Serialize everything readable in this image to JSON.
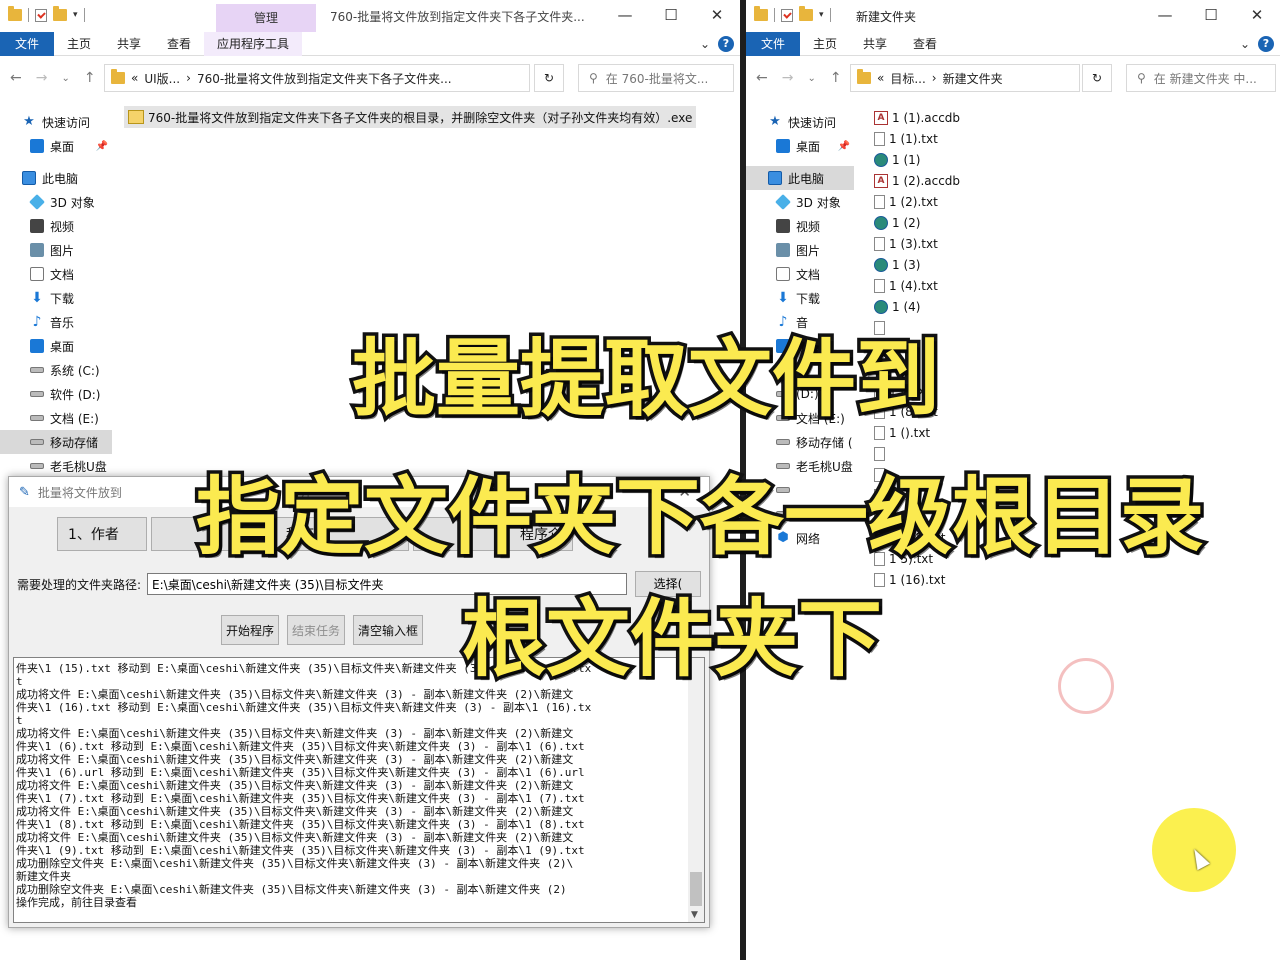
{
  "left": {
    "manage_tab": "管理",
    "title": "760-批量将文件放到指定文件夹下各子文件夹...",
    "ribbon": [
      "文件",
      "主页",
      "共享",
      "查看",
      "应用程序工具"
    ],
    "address": {
      "prefix": "«",
      "crumb1": "UI版...",
      "crumb2": "760-批量将文件放到指定文件夹下各子文件夹..."
    },
    "search_placeholder": "在 760-批量将文...",
    "selected_file": "760-批量将文件放到指定文件夹下各子文件夹的根目录，并删除空文件夹（对子孙文件夹均有效）.exe",
    "nav": [
      {
        "label": "快速访问",
        "icon": "star-icon"
      },
      {
        "label": "桌面",
        "icon": "desktop-icon",
        "pin": true
      },
      {
        "label": "此电脑",
        "icon": "computer-icon"
      },
      {
        "label": "3D 对象",
        "icon": "cube-icon"
      },
      {
        "label": "视频",
        "icon": "video-icon"
      },
      {
        "label": "图片",
        "icon": "picture-icon"
      },
      {
        "label": "文档",
        "icon": "document-icon"
      },
      {
        "label": "下载",
        "icon": "download-icon"
      },
      {
        "label": "音乐",
        "icon": "music-icon"
      },
      {
        "label": "桌面",
        "icon": "desktop-icon"
      },
      {
        "label": "系统 (C:)",
        "icon": "drive-icon"
      },
      {
        "label": "软件 (D:)",
        "icon": "drive-icon"
      },
      {
        "label": "文档 (E:)",
        "icon": "drive-icon"
      },
      {
        "label": "移动存储",
        "icon": "drive-icon",
        "selected": true
      },
      {
        "label": "老毛桃U盘",
        "icon": "drive-icon"
      }
    ]
  },
  "right": {
    "title": "新建文件夹",
    "ribbon": [
      "文件",
      "主页",
      "共享",
      "查看"
    ],
    "address": {
      "prefix": "«",
      "crumb1": "目标...",
      "crumb2": "新建文件夹"
    },
    "search_placeholder": "在 新建文件夹 中...",
    "nav": [
      {
        "label": "快速访问",
        "icon": "star-icon"
      },
      {
        "label": "桌面",
        "icon": "desktop-icon",
        "pin": true
      },
      {
        "label": "此电脑",
        "icon": "computer-icon",
        "selected": true
      },
      {
        "label": "3D 对象",
        "icon": "cube-icon"
      },
      {
        "label": "视频",
        "icon": "video-icon"
      },
      {
        "label": "图片",
        "icon": "picture-icon"
      },
      {
        "label": "文档",
        "icon": "document-icon"
      },
      {
        "label": "下载",
        "icon": "download-icon"
      },
      {
        "label": "音",
        "icon": "music-icon"
      },
      {
        "label": "",
        "icon": "desktop-icon"
      },
      {
        "label": "",
        "icon": "drive-icon"
      },
      {
        "label": "(D:)",
        "icon": "drive-icon"
      },
      {
        "label": "文档 (E:)",
        "icon": "drive-icon"
      },
      {
        "label": "移动存储 (",
        "icon": "drive-icon"
      },
      {
        "label": "老毛桃U盘",
        "icon": "drive-icon"
      },
      {
        "label": "",
        "icon": "drive-icon"
      },
      {
        "label": "移动存储 (F",
        "icon": "drive-icon"
      },
      {
        "label": "网络",
        "icon": "network-icon"
      }
    ],
    "files": [
      {
        "name": "1 (1).accdb",
        "icon": "accdb"
      },
      {
        "name": "1 (1).txt",
        "icon": "txt"
      },
      {
        "name": "1 (1)",
        "icon": "url"
      },
      {
        "name": "1 (2).accdb",
        "icon": "accdb"
      },
      {
        "name": "1 (2).txt",
        "icon": "txt"
      },
      {
        "name": "1 (2)",
        "icon": "url"
      },
      {
        "name": "1 (3).txt",
        "icon": "txt"
      },
      {
        "name": "1 (3)",
        "icon": "url"
      },
      {
        "name": "1 (4).txt",
        "icon": "txt"
      },
      {
        "name": "1 (4)",
        "icon": "url"
      },
      {
        "name": "",
        "icon": "txt"
      },
      {
        "name": "",
        "icon": "txt"
      },
      {
        "name": "",
        "icon": "url"
      },
      {
        "name": "1 ().txt",
        "icon": "txt"
      },
      {
        "name": "1 (8).txt",
        "icon": "txt"
      },
      {
        "name": "1 ().txt",
        "icon": "txt"
      },
      {
        "name": "",
        "icon": "txt"
      },
      {
        "name": "",
        "icon": "txt"
      },
      {
        "name": "",
        "icon": "txt"
      },
      {
        "name": "",
        "icon": "txt"
      },
      {
        "name": "1 (14).txt",
        "icon": "txt"
      },
      {
        "name": "1 5).txt",
        "icon": "txt"
      },
      {
        "name": "1 (16).txt",
        "icon": "txt"
      }
    ]
  },
  "dialog": {
    "title": "批量将文件放到",
    "title_rest": "开",
    "tabs": [
      "1、作者",
      "",
      "程序",
      "",
      "程序介"
    ],
    "path_label": "需要处理的文件夹路径:",
    "path_value": "E:\\桌面\\ceshi\\新建文件夹 (35)\\目标文件夹",
    "browse_label": "选择(",
    "buttons": {
      "start": "开始程序",
      "stop": "结束任务",
      "clear": "清空输入框"
    },
    "log": "件夹\\1 (15).txt 移动到 E:\\桌面\\ceshi\\新建文件夹 (35)\\目标文件夹\\新建文件夹 (3) - 副本\\1 (15).tx\nt\n成功将文件 E:\\桌面\\ceshi\\新建文件夹 (35)\\目标文件夹\\新建文件夹 (3) - 副本\\新建文件夹 (2)\\新建文\n件夹\\1 (16).txt 移动到 E:\\桌面\\ceshi\\新建文件夹 (35)\\目标文件夹\\新建文件夹 (3) - 副本\\1 (16).tx\nt\n成功将文件 E:\\桌面\\ceshi\\新建文件夹 (35)\\目标文件夹\\新建文件夹 (3) - 副本\\新建文件夹 (2)\\新建文\n件夹\\1 (6).txt 移动到 E:\\桌面\\ceshi\\新建文件夹 (35)\\目标文件夹\\新建文件夹 (3) - 副本\\1 (6).txt\n成功将文件 E:\\桌面\\ceshi\\新建文件夹 (35)\\目标文件夹\\新建文件夹 (3) - 副本\\新建文件夹 (2)\\新建文\n件夹\\1 (6).url 移动到 E:\\桌面\\ceshi\\新建文件夹 (35)\\目标文件夹\\新建文件夹 (3) - 副本\\1 (6).url\n成功将文件 E:\\桌面\\ceshi\\新建文件夹 (35)\\目标文件夹\\新建文件夹 (3) - 副本\\新建文件夹 (2)\\新建文\n件夹\\1 (7).txt 移动到 E:\\桌面\\ceshi\\新建文件夹 (35)\\目标文件夹\\新建文件夹 (3) - 副本\\1 (7).txt\n成功将文件 E:\\桌面\\ceshi\\新建文件夹 (35)\\目标文件夹\\新建文件夹 (3) - 副本\\新建文件夹 (2)\\新建文\n件夹\\1 (8).txt 移动到 E:\\桌面\\ceshi\\新建文件夹 (35)\\目标文件夹\\新建文件夹 (3) - 副本\\1 (8).txt\n成功将文件 E:\\桌面\\ceshi\\新建文件夹 (35)\\目标文件夹\\新建文件夹 (3) - 副本\\新建文件夹 (2)\\新建文\n件夹\\1 (9).txt 移动到 E:\\桌面\\ceshi\\新建文件夹 (35)\\目标文件夹\\新建文件夹 (3) - 副本\\1 (9).txt\n成功删除空文件夹 E:\\桌面\\ceshi\\新建文件夹 (35)\\目标文件夹\\新建文件夹 (3) - 副本\\新建文件夹 (2)\\\n新建文件夹\n成功删除空文件夹 E:\\桌面\\ceshi\\新建文件夹 (35)\\目标文件夹\\新建文件夹 (3) - 副本\\新建文件夹 (2)\n操作完成，前往目录查看"
  },
  "overlay": {
    "line1": "批量提取文件到",
    "line2": "指定文件夹下各一级根目录",
    "line3": "根文件夹下"
  },
  "colors": {
    "accent": "#1a64b4",
    "manage": "#e7d4f5",
    "overlay_text": "#fbea50"
  }
}
